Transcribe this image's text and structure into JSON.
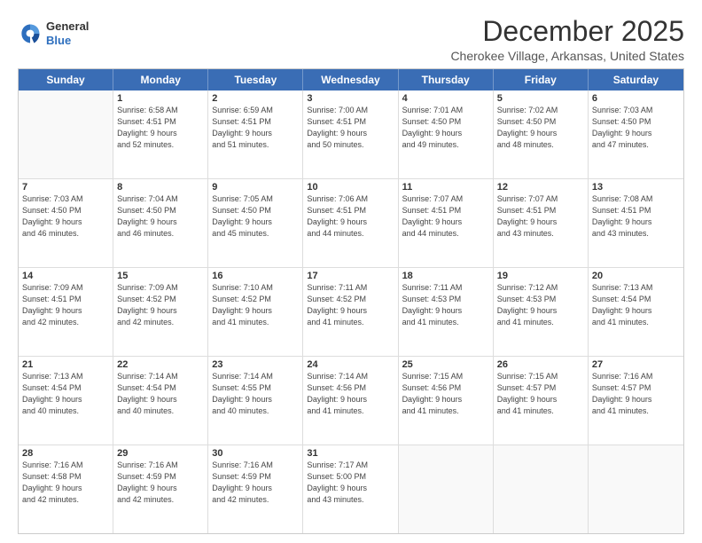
{
  "header": {
    "logo_general": "General",
    "logo_blue": "Blue",
    "month_year": "December 2025",
    "location": "Cherokee Village, Arkansas, United States"
  },
  "weekdays": [
    "Sunday",
    "Monday",
    "Tuesday",
    "Wednesday",
    "Thursday",
    "Friday",
    "Saturday"
  ],
  "weeks": [
    [
      {
        "day": "",
        "info": ""
      },
      {
        "day": "1",
        "info": "Sunrise: 6:58 AM\nSunset: 4:51 PM\nDaylight: 9 hours\nand 52 minutes."
      },
      {
        "day": "2",
        "info": "Sunrise: 6:59 AM\nSunset: 4:51 PM\nDaylight: 9 hours\nand 51 minutes."
      },
      {
        "day": "3",
        "info": "Sunrise: 7:00 AM\nSunset: 4:51 PM\nDaylight: 9 hours\nand 50 minutes."
      },
      {
        "day": "4",
        "info": "Sunrise: 7:01 AM\nSunset: 4:50 PM\nDaylight: 9 hours\nand 49 minutes."
      },
      {
        "day": "5",
        "info": "Sunrise: 7:02 AM\nSunset: 4:50 PM\nDaylight: 9 hours\nand 48 minutes."
      },
      {
        "day": "6",
        "info": "Sunrise: 7:03 AM\nSunset: 4:50 PM\nDaylight: 9 hours\nand 47 minutes."
      }
    ],
    [
      {
        "day": "7",
        "info": "Sunrise: 7:03 AM\nSunset: 4:50 PM\nDaylight: 9 hours\nand 46 minutes."
      },
      {
        "day": "8",
        "info": "Sunrise: 7:04 AM\nSunset: 4:50 PM\nDaylight: 9 hours\nand 46 minutes."
      },
      {
        "day": "9",
        "info": "Sunrise: 7:05 AM\nSunset: 4:50 PM\nDaylight: 9 hours\nand 45 minutes."
      },
      {
        "day": "10",
        "info": "Sunrise: 7:06 AM\nSunset: 4:51 PM\nDaylight: 9 hours\nand 44 minutes."
      },
      {
        "day": "11",
        "info": "Sunrise: 7:07 AM\nSunset: 4:51 PM\nDaylight: 9 hours\nand 44 minutes."
      },
      {
        "day": "12",
        "info": "Sunrise: 7:07 AM\nSunset: 4:51 PM\nDaylight: 9 hours\nand 43 minutes."
      },
      {
        "day": "13",
        "info": "Sunrise: 7:08 AM\nSunset: 4:51 PM\nDaylight: 9 hours\nand 43 minutes."
      }
    ],
    [
      {
        "day": "14",
        "info": "Sunrise: 7:09 AM\nSunset: 4:51 PM\nDaylight: 9 hours\nand 42 minutes."
      },
      {
        "day": "15",
        "info": "Sunrise: 7:09 AM\nSunset: 4:52 PM\nDaylight: 9 hours\nand 42 minutes."
      },
      {
        "day": "16",
        "info": "Sunrise: 7:10 AM\nSunset: 4:52 PM\nDaylight: 9 hours\nand 41 minutes."
      },
      {
        "day": "17",
        "info": "Sunrise: 7:11 AM\nSunset: 4:52 PM\nDaylight: 9 hours\nand 41 minutes."
      },
      {
        "day": "18",
        "info": "Sunrise: 7:11 AM\nSunset: 4:53 PM\nDaylight: 9 hours\nand 41 minutes."
      },
      {
        "day": "19",
        "info": "Sunrise: 7:12 AM\nSunset: 4:53 PM\nDaylight: 9 hours\nand 41 minutes."
      },
      {
        "day": "20",
        "info": "Sunrise: 7:13 AM\nSunset: 4:54 PM\nDaylight: 9 hours\nand 41 minutes."
      }
    ],
    [
      {
        "day": "21",
        "info": "Sunrise: 7:13 AM\nSunset: 4:54 PM\nDaylight: 9 hours\nand 40 minutes."
      },
      {
        "day": "22",
        "info": "Sunrise: 7:14 AM\nSunset: 4:54 PM\nDaylight: 9 hours\nand 40 minutes."
      },
      {
        "day": "23",
        "info": "Sunrise: 7:14 AM\nSunset: 4:55 PM\nDaylight: 9 hours\nand 40 minutes."
      },
      {
        "day": "24",
        "info": "Sunrise: 7:14 AM\nSunset: 4:56 PM\nDaylight: 9 hours\nand 41 minutes."
      },
      {
        "day": "25",
        "info": "Sunrise: 7:15 AM\nSunset: 4:56 PM\nDaylight: 9 hours\nand 41 minutes."
      },
      {
        "day": "26",
        "info": "Sunrise: 7:15 AM\nSunset: 4:57 PM\nDaylight: 9 hours\nand 41 minutes."
      },
      {
        "day": "27",
        "info": "Sunrise: 7:16 AM\nSunset: 4:57 PM\nDaylight: 9 hours\nand 41 minutes."
      }
    ],
    [
      {
        "day": "28",
        "info": "Sunrise: 7:16 AM\nSunset: 4:58 PM\nDaylight: 9 hours\nand 42 minutes."
      },
      {
        "day": "29",
        "info": "Sunrise: 7:16 AM\nSunset: 4:59 PM\nDaylight: 9 hours\nand 42 minutes."
      },
      {
        "day": "30",
        "info": "Sunrise: 7:16 AM\nSunset: 4:59 PM\nDaylight: 9 hours\nand 42 minutes."
      },
      {
        "day": "31",
        "info": "Sunrise: 7:17 AM\nSunset: 5:00 PM\nDaylight: 9 hours\nand 43 minutes."
      },
      {
        "day": "",
        "info": ""
      },
      {
        "day": "",
        "info": ""
      },
      {
        "day": "",
        "info": ""
      }
    ]
  ]
}
